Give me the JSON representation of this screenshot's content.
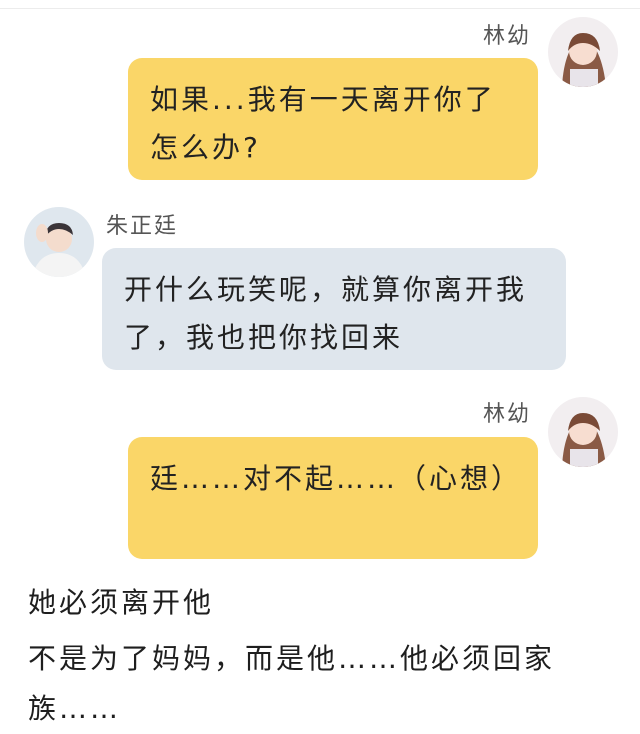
{
  "messages": [
    {
      "sender": "林幼",
      "side": "right",
      "text": "如果...我有一天离开你了怎么办?"
    },
    {
      "sender": "朱正廷",
      "side": "left",
      "text": "开什么玩笑呢，就算你离开我了，我也把你找回来"
    },
    {
      "sender": "林幼",
      "side": "right",
      "text": "廷……对不起……（心想）"
    }
  ],
  "caption": {
    "line1": "她必须离开他",
    "line2": "不是为了妈妈，而是他……他必须回家族……"
  },
  "colors": {
    "self_bubble": "#fad668",
    "other_bubble": "#dfe6ed",
    "name_text": "#555555"
  }
}
